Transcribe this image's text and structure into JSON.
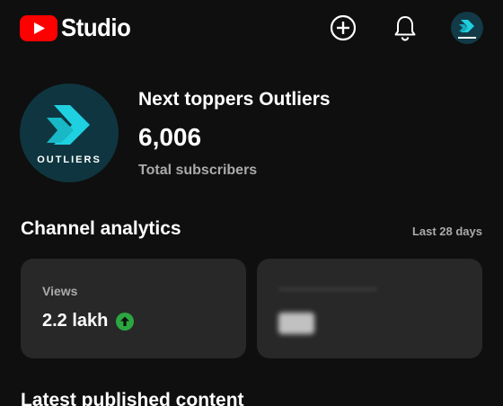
{
  "header": {
    "app_name": "Studio",
    "icons": [
      "youtube-logo-icon",
      "create-plus-icon",
      "bell-icon",
      "account-avatar"
    ]
  },
  "channel": {
    "name": "Next toppers Outliers",
    "subscribers": "6,006",
    "subscribers_label": "Total subscribers",
    "avatar_text": "OUTLIERS"
  },
  "analytics": {
    "title": "Channel analytics",
    "period": "Last 28 days",
    "cards": [
      {
        "label": "Views",
        "value": "2.2 lakh",
        "trend": "up"
      }
    ]
  },
  "latest": {
    "title": "Latest published content"
  },
  "colors": {
    "background": "#0f0f0f",
    "card": "#282828",
    "brand_red": "#ff0000",
    "trend_green": "#2ba640",
    "teal_brand": "#1fd0e0"
  }
}
